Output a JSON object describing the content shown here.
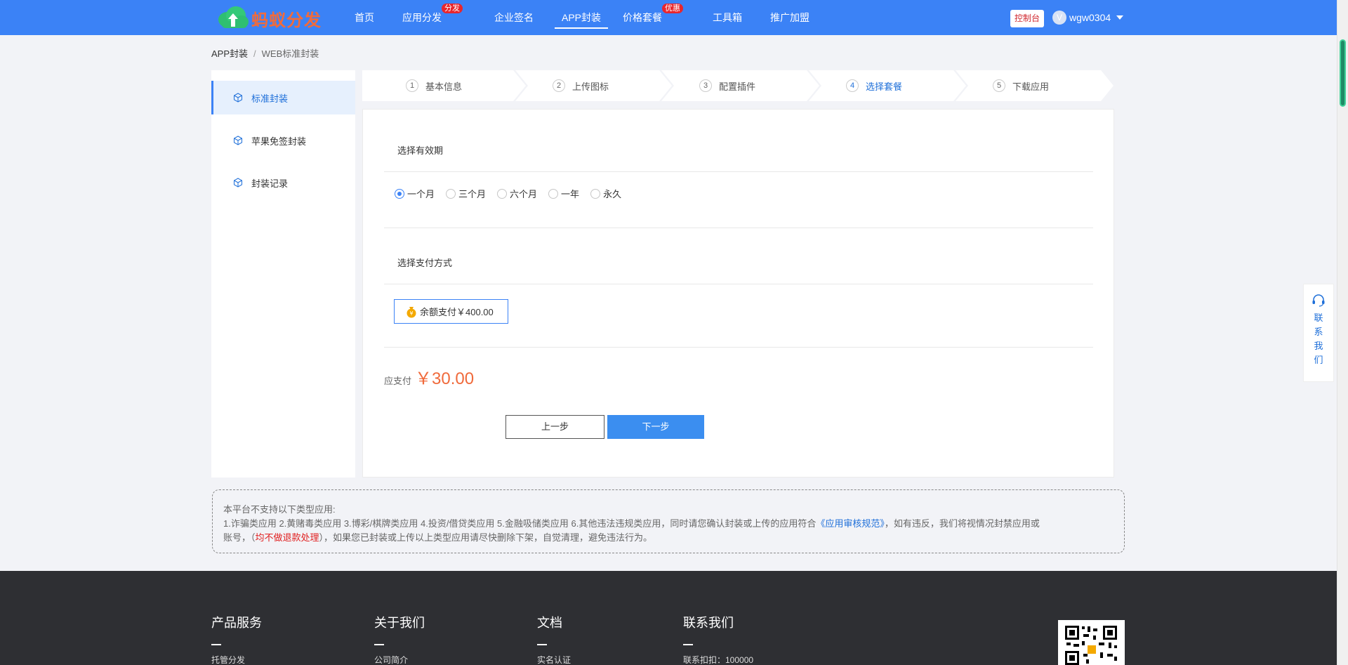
{
  "header": {
    "logo_text": "蚂蚁分发",
    "nav": [
      {
        "label": "首页",
        "badge": ""
      },
      {
        "label": "应用分发",
        "badge": "分发"
      },
      {
        "label": "企业签名",
        "badge": ""
      },
      {
        "label": "APP封装",
        "badge": "",
        "active": true
      },
      {
        "label": "价格套餐",
        "badge": "优惠"
      },
      {
        "label": "工具箱",
        "badge": ""
      },
      {
        "label": "推广加盟",
        "badge": ""
      }
    ],
    "console_label": "控制台",
    "avatar_letter": "V",
    "username": "wgw0304"
  },
  "breadcrumb": {
    "root": "APP封装",
    "separator": "/",
    "current": "WEB标准封装"
  },
  "sidebar": {
    "items": [
      {
        "label": "标准封装",
        "active": true
      },
      {
        "label": "苹果免签封装",
        "active": false
      },
      {
        "label": "封装记录",
        "active": false
      }
    ]
  },
  "steps": [
    {
      "num": "1",
      "label": "基本信息"
    },
    {
      "num": "2",
      "label": "上传图标"
    },
    {
      "num": "3",
      "label": "配置插件"
    },
    {
      "num": "4",
      "label": "选择套餐",
      "active": true
    },
    {
      "num": "5",
      "label": "下载应用"
    }
  ],
  "validity": {
    "title": "选择有效期",
    "options": [
      {
        "label": "一个月",
        "checked": true
      },
      {
        "label": "三个月",
        "checked": false
      },
      {
        "label": "六个月",
        "checked": false
      },
      {
        "label": "一年",
        "checked": false
      },
      {
        "label": "永久",
        "checked": false
      }
    ]
  },
  "payment": {
    "title": "选择支付方式",
    "option_label": "余额支付￥400.00"
  },
  "due": {
    "label": "应支付",
    "amount": "￥30.00"
  },
  "buttons": {
    "prev": "上一步",
    "next": "下一步"
  },
  "notice": {
    "line1": "本平台不支持以下类型应用:",
    "line2_a": "1.诈骗类应用 2.黄赌毒类应用 3.博彩/棋牌类应用 4.投资/借贷类应用 5.金融吸储类应用 6.其他违法违规类应用，同时请您确认封装或上传的应用符合",
    "link": "《应用审核规范》",
    "line2_b": "，如有违反，我们将视情况封禁应用或",
    "line3_a": "账号，（",
    "warn": "均不做退款处理",
    "line3_b": "），如果您已封装或上传以上类型应用请尽快删除下架，自觉清理，避免违法行为。"
  },
  "footer": {
    "columns": [
      {
        "title": "产品服务",
        "first_item": "托管分发"
      },
      {
        "title": "关于我们",
        "first_item": "公司简介"
      },
      {
        "title": "文档",
        "first_item": "实名认证"
      },
      {
        "title": "联系我们",
        "first_item": "联系扣扣：100000"
      }
    ]
  },
  "contact": {
    "label": "联系我们"
  },
  "colors": {
    "primary": "#3b82f6",
    "logo_orange": "#f26b3a",
    "price": "#f06a3b",
    "badge_red": "#e8262d",
    "footer_bg": "#2e2f33"
  }
}
